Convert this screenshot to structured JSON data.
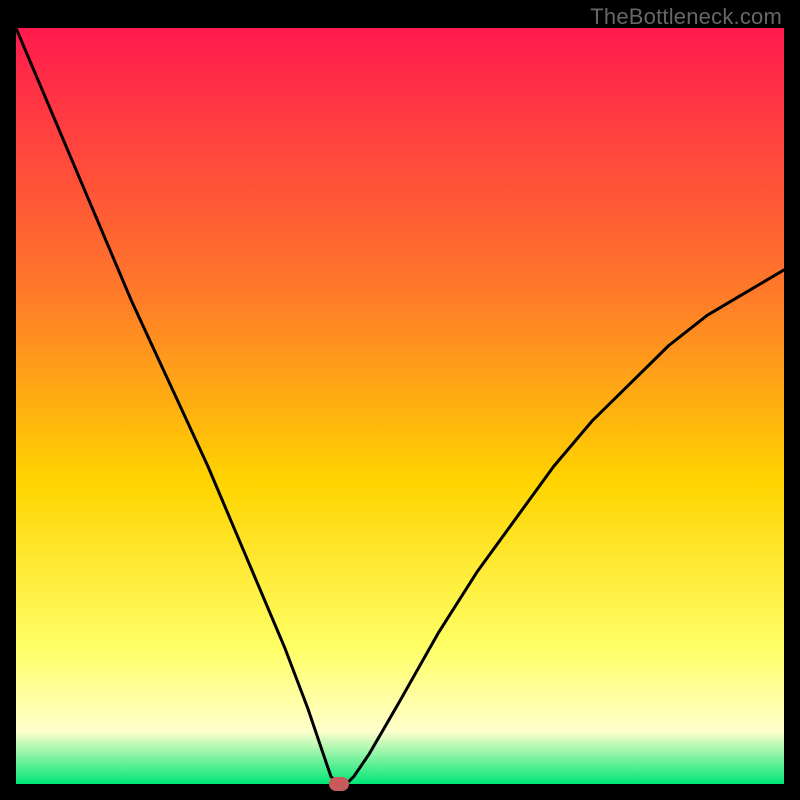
{
  "watermark": "TheBottleneck.com",
  "colors": {
    "frame": "#000000",
    "grad_top": "#ff1a4d",
    "grad_mid1": "#ff7a2a",
    "grad_mid2": "#ffd400",
    "grad_mid3": "#ffff66",
    "grad_mid4": "#ffffcc",
    "grad_bot": "#00e676",
    "curve": "#000000",
    "marker": "#c75a5a"
  },
  "chart_data": {
    "type": "line",
    "title": "",
    "xlabel": "",
    "ylabel": "",
    "xlim": [
      0,
      100
    ],
    "ylim": [
      0,
      100
    ],
    "minimum_x": 42,
    "series": [
      {
        "name": "bottleneck-curve",
        "x": [
          0,
          5,
          10,
          15,
          20,
          25,
          30,
          35,
          38,
          40,
          41,
          42,
          43,
          44,
          46,
          50,
          55,
          60,
          65,
          70,
          75,
          80,
          85,
          90,
          95,
          100
        ],
        "y": [
          100,
          88,
          76,
          64,
          53,
          42,
          30,
          18,
          10,
          4,
          1,
          0,
          0,
          1,
          4,
          11,
          20,
          28,
          35,
          42,
          48,
          53,
          58,
          62,
          65,
          68
        ]
      }
    ],
    "marker": {
      "x": 42,
      "y": 0
    }
  }
}
